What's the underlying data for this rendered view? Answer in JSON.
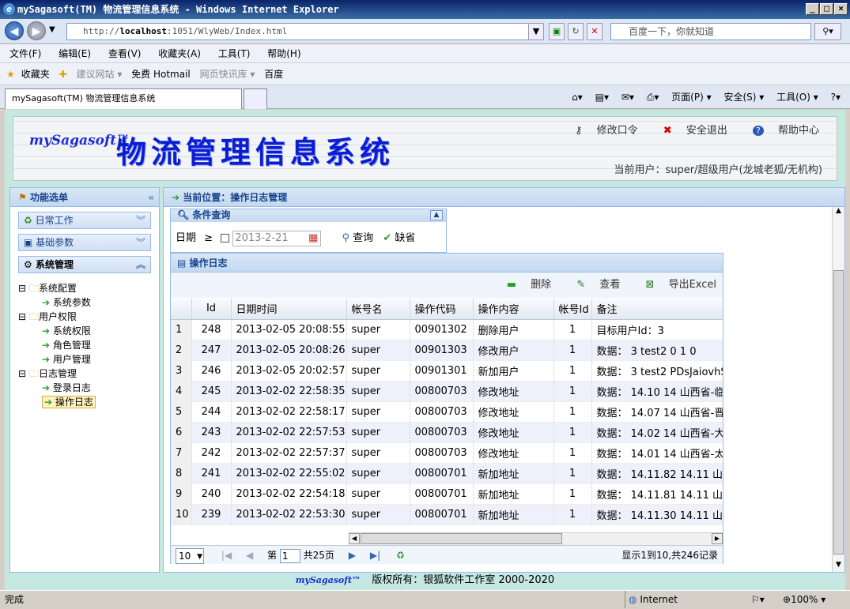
{
  "window": {
    "title": "mySagasoft(TM) 物流管理信息系统 - Windows Internet Explorer"
  },
  "browser": {
    "url_prefix": "http://",
    "url_host": "localhost",
    "url_rest": ":1051/WlyWeb/Index.html",
    "search_placeholder": "百度一下，你就知道",
    "menu": [
      "文件(F)",
      "编辑(E)",
      "查看(V)",
      "收藏夹(A)",
      "工具(T)",
      "帮助(H)"
    ],
    "favorites": [
      "收藏夹",
      "建议网站 ▾",
      "免费 Hotmail",
      "网页快讯库 ▾",
      "百度"
    ],
    "tab_title": "mySagasoft(TM) 物流管理信息系统",
    "tab_tools": [
      "页面(P) ▾",
      "安全(S) ▾",
      "工具(O) ▾"
    ]
  },
  "header": {
    "logo": "mySagasoft™",
    "system_title": "物流管理信息系统",
    "links": {
      "change_password": "修改口令",
      "logout": "安全退出",
      "help": "帮助中心"
    },
    "current_user": "当前用户：super/超级用户(龙城老狐/无机构)"
  },
  "sidebar": {
    "title": "功能选单",
    "sections": [
      "日常工作",
      "基础参数",
      "系统管理"
    ],
    "tree": {
      "config": "系统配置",
      "config_params": "系统参数",
      "perm": "用户权限",
      "perm_sys": "系统权限",
      "perm_role": "角色管理",
      "perm_user": "用户管理",
      "log": "日志管理",
      "log_login": "登录日志",
      "log_op": "操作日志"
    }
  },
  "breadcrumb": "当前位置：操作日志管理",
  "query": {
    "title": "条件查询",
    "date_label": "日期",
    "op": "≥",
    "date_placeholder": "2013-2-21",
    "search": "查询",
    "default": "缺省"
  },
  "grid": {
    "title": "操作日志",
    "toolbar": {
      "delete": "删除",
      "view": "查看",
      "export": "导出Excel"
    },
    "columns": [
      "Id",
      "日期时间",
      "帐号名",
      "操作代码",
      "操作内容",
      "帐号Id",
      "备注"
    ],
    "rows": [
      {
        "n": "1",
        "id": "248",
        "dt": "2013-02-05 20:08:55",
        "acct": "super",
        "code": "00901302",
        "op": "删除用户",
        "aid": "1",
        "note": "目标用户Id：3"
      },
      {
        "n": "2",
        "id": "247",
        "dt": "2013-02-05 20:08:26",
        "acct": "super",
        "code": "00901303",
        "op": "修改用户",
        "aid": "1",
        "note": "数据： 3 test2 0 1 0"
      },
      {
        "n": "3",
        "id": "246",
        "dt": "2013-02-05 20:02:57",
        "acct": "super",
        "code": "00901301",
        "op": "新加用户",
        "aid": "1",
        "note": "数据： 3 test2 PDsJaiovhS"
      },
      {
        "n": "4",
        "id": "245",
        "dt": "2013-02-02 22:58:35",
        "acct": "super",
        "code": "00800703",
        "op": "修改地址",
        "aid": "1",
        "note": "数据： 14.10 14 山西省-临"
      },
      {
        "n": "5",
        "id": "244",
        "dt": "2013-02-02 22:58:17",
        "acct": "super",
        "code": "00800703",
        "op": "修改地址",
        "aid": "1",
        "note": "数据： 14.07 14 山西省-晋"
      },
      {
        "n": "6",
        "id": "243",
        "dt": "2013-02-02 22:57:53",
        "acct": "super",
        "code": "00800703",
        "op": "修改地址",
        "aid": "1",
        "note": "数据： 14.02 14 山西省-大"
      },
      {
        "n": "7",
        "id": "242",
        "dt": "2013-02-02 22:57:37",
        "acct": "super",
        "code": "00800703",
        "op": "修改地址",
        "aid": "1",
        "note": "数据： 14.01 14 山西省-太"
      },
      {
        "n": "8",
        "id": "241",
        "dt": "2013-02-02 22:55:02",
        "acct": "super",
        "code": "00800701",
        "op": "新加地址",
        "aid": "1",
        "note": "数据： 14.11.82 14.11 山西"
      },
      {
        "n": "9",
        "id": "240",
        "dt": "2013-02-02 22:54:18",
        "acct": "super",
        "code": "00800701",
        "op": "新加地址",
        "aid": "1",
        "note": "数据： 14.11.81 14.11 山西"
      },
      {
        "n": "10",
        "id": "239",
        "dt": "2013-02-02 22:53:30",
        "acct": "super",
        "code": "00800701",
        "op": "新加地址",
        "aid": "1",
        "note": "数据： 14.11.30 14.11 山西"
      }
    ],
    "pager": {
      "page_size": "10",
      "page_label": "第",
      "page": "1",
      "total_pages": "共25页",
      "summary": "显示1到10,共246记录"
    }
  },
  "footer": {
    "logo": "mySagasoft™",
    "copyright": "版权所有：银狐软件工作室 2000-2020"
  },
  "status": {
    "text": "完成",
    "zone": "Internet",
    "zoom": "100%"
  },
  "colors": {
    "accent": "#15428b",
    "header_bg": "#c5e8e0",
    "title_blue": "#0b1dd0"
  }
}
